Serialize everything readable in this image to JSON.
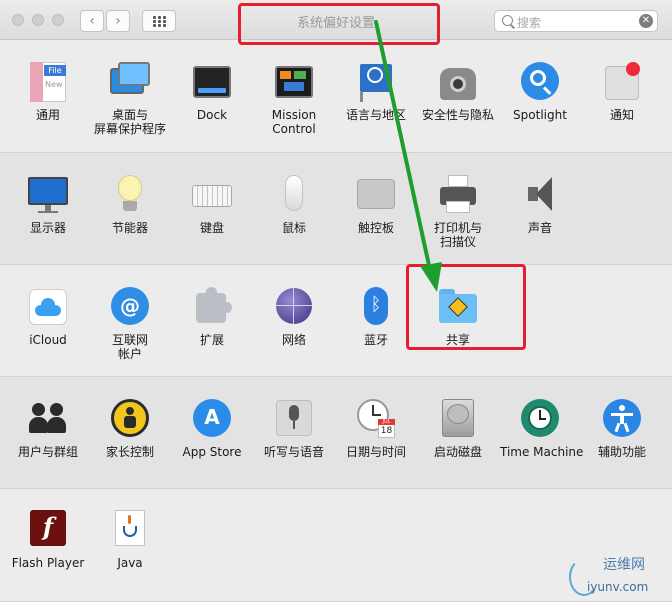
{
  "window": {
    "title": "系统偏好设置"
  },
  "toolbar": {
    "back": "‹",
    "forward": "›"
  },
  "search": {
    "placeholder": "搜索",
    "clear": "✕"
  },
  "rows": [
    [
      {
        "name": "general",
        "label": "通用",
        "icon": "general-icon"
      },
      {
        "name": "desktop",
        "label": "桌面与\n屏幕保护程序",
        "icon": "desktop-icon"
      },
      {
        "name": "dock",
        "label": "Dock",
        "icon": "dock-icon"
      },
      {
        "name": "mission-control",
        "label": "Mission\nControl",
        "icon": "mission-control-icon"
      },
      {
        "name": "language",
        "label": "语言与地区",
        "icon": "language-icon"
      },
      {
        "name": "security",
        "label": "安全性与隐私",
        "icon": "security-icon"
      },
      {
        "name": "spotlight",
        "label": "Spotlight",
        "icon": "spotlight-icon"
      },
      {
        "name": "notifications",
        "label": "通知",
        "icon": "notifications-icon"
      }
    ],
    [
      {
        "name": "displays",
        "label": "显示器",
        "icon": "displays-icon"
      },
      {
        "name": "energy",
        "label": "节能器",
        "icon": "energy-icon"
      },
      {
        "name": "keyboard",
        "label": "键盘",
        "icon": "keyboard-icon"
      },
      {
        "name": "mouse",
        "label": "鼠标",
        "icon": "mouse-icon"
      },
      {
        "name": "trackpad",
        "label": "触控板",
        "icon": "trackpad-icon"
      },
      {
        "name": "printers",
        "label": "打印机与\n扫描仪",
        "icon": "printer-icon"
      },
      {
        "name": "sound",
        "label": "声音",
        "icon": "sound-icon"
      }
    ],
    [
      {
        "name": "icloud",
        "label": "iCloud",
        "icon": "icloud-icon"
      },
      {
        "name": "internet-accounts",
        "label": "互联网\n帐户",
        "icon": "internet-accounts-icon"
      },
      {
        "name": "extensions",
        "label": "扩展",
        "icon": "extensions-icon"
      },
      {
        "name": "network",
        "label": "网络",
        "icon": "network-icon"
      },
      {
        "name": "bluetooth",
        "label": "蓝牙",
        "icon": "bluetooth-icon"
      },
      {
        "name": "sharing",
        "label": "共享",
        "icon": "sharing-icon"
      }
    ],
    [
      {
        "name": "users",
        "label": "用户与群组",
        "icon": "users-icon"
      },
      {
        "name": "parental",
        "label": "家长控制",
        "icon": "parental-controls-icon"
      },
      {
        "name": "app-store",
        "label": "App Store",
        "icon": "app-store-icon"
      },
      {
        "name": "dictation",
        "label": "听写与语音",
        "icon": "microphone-icon"
      },
      {
        "name": "date-time",
        "label": "日期与时间",
        "icon": "clock-icon"
      },
      {
        "name": "startup-disk",
        "label": "启动磁盘",
        "icon": "disk-icon"
      },
      {
        "name": "time-machine",
        "label": "Time Machine",
        "icon": "time-machine-icon"
      },
      {
        "name": "accessibility",
        "label": "辅助功能",
        "icon": "accessibility-icon"
      }
    ],
    [
      {
        "name": "flash-player",
        "label": "Flash Player",
        "icon": "flash-icon"
      },
      {
        "name": "java",
        "label": "Java",
        "icon": "java-icon"
      }
    ]
  ],
  "icon_text": {
    "general_file": "File",
    "general_new": "New",
    "calendar_month": "JUL",
    "calendar_day": "18",
    "flash": "f"
  },
  "watermark": {
    "brand": "运维网",
    "domain": "iyunv.com"
  },
  "colors": {
    "highlight": "#e2202f",
    "arrow": "#1e9e2e"
  }
}
